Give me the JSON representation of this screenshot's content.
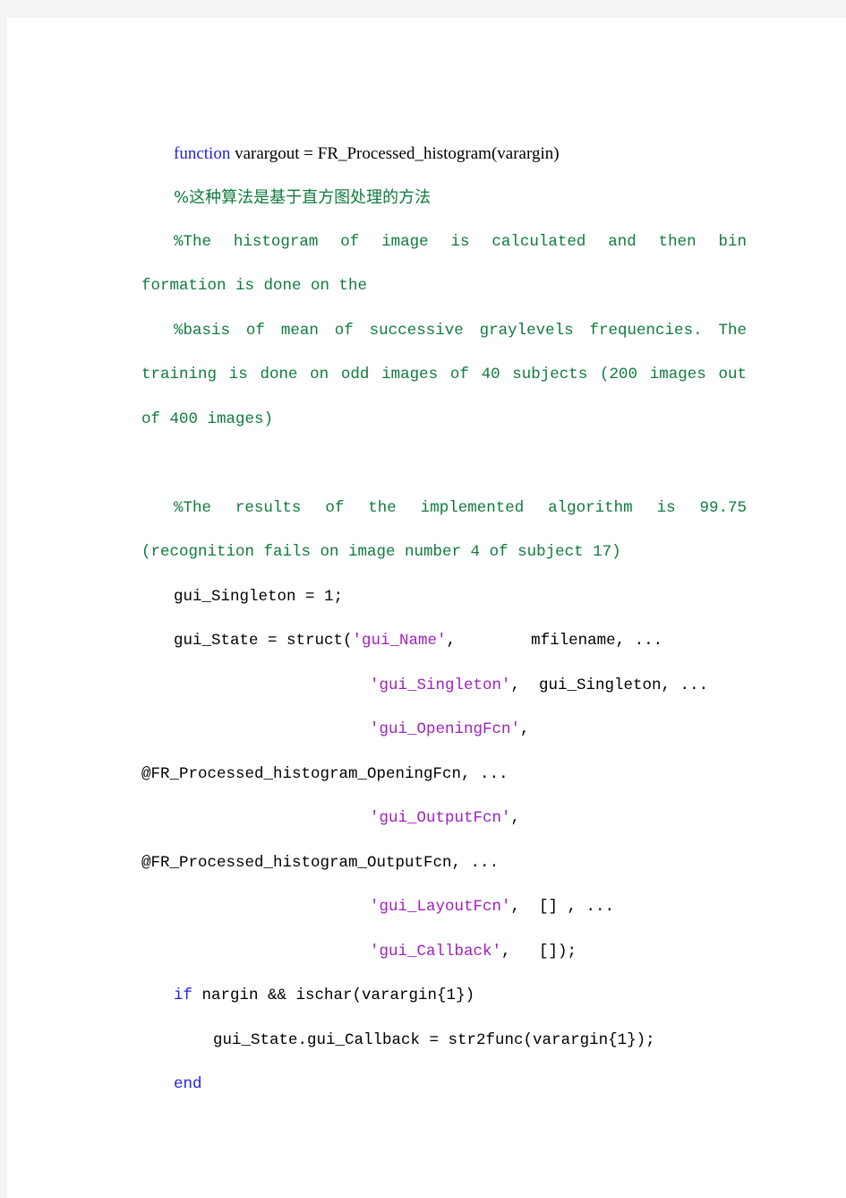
{
  "document": {
    "background_color": "#f4f4f4",
    "page_color": "#ffffff",
    "language": "MATLAB",
    "colors": {
      "keyword": "#2222dd",
      "comment": "#0f7b3d",
      "string": "#a020c0",
      "code": "#000000"
    }
  },
  "code": {
    "line_01": {
      "keyword": "function",
      "rest": " varargout = FR_Processed_histogram(varargin)"
    },
    "line_02": {
      "comment": "%这种算法是基于直方图处理的方法"
    },
    "line_03": {
      "comment": "%The histogram of image is calculated and then bin"
    },
    "line_04": {
      "comment": "formation is done on the"
    },
    "line_05": {
      "comment": "%basis of mean of successive graylevels frequencies. The"
    },
    "line_06": {
      "comment": "training is done on odd images of 40 subjects (200 images out"
    },
    "line_07": {
      "comment": "of 400 images)"
    },
    "line_08": {
      "comment": ""
    },
    "line_09": {
      "comment": "%The results of the implemented algorithm is 99.75"
    },
    "line_10": {
      "comment": "(recognition fails on image number 4 of subject 17)"
    },
    "line_11": {
      "code": "gui_Singleton = 1;"
    },
    "line_12": {
      "pre": "gui_State = struct(",
      "string": "'gui_Name'",
      "post": ",        mfilename, ..."
    },
    "line_13": {
      "string": "'gui_Singleton'",
      "post": ",  gui_Singleton, ..."
    },
    "line_14": {
      "string": "'gui_OpeningFcn'",
      "post": ","
    },
    "line_15": {
      "code": "@FR_Processed_histogram_OpeningFcn, ..."
    },
    "line_16": {
      "string": "'gui_OutputFcn'",
      "post": ","
    },
    "line_17": {
      "code": "@FR_Processed_histogram_OutputFcn, ..."
    },
    "line_18": {
      "string": "'gui_LayoutFcn'",
      "post": ",  [] , ..."
    },
    "line_19": {
      "string": "'gui_Callback'",
      "post": ",   []);"
    },
    "line_20": {
      "keyword": "if",
      "rest": " nargin && ischar(varargin{1})"
    },
    "line_21": {
      "code": "gui_State.gui_Callback = str2func(varargin{1});"
    },
    "line_22": {
      "keyword": "end"
    }
  }
}
